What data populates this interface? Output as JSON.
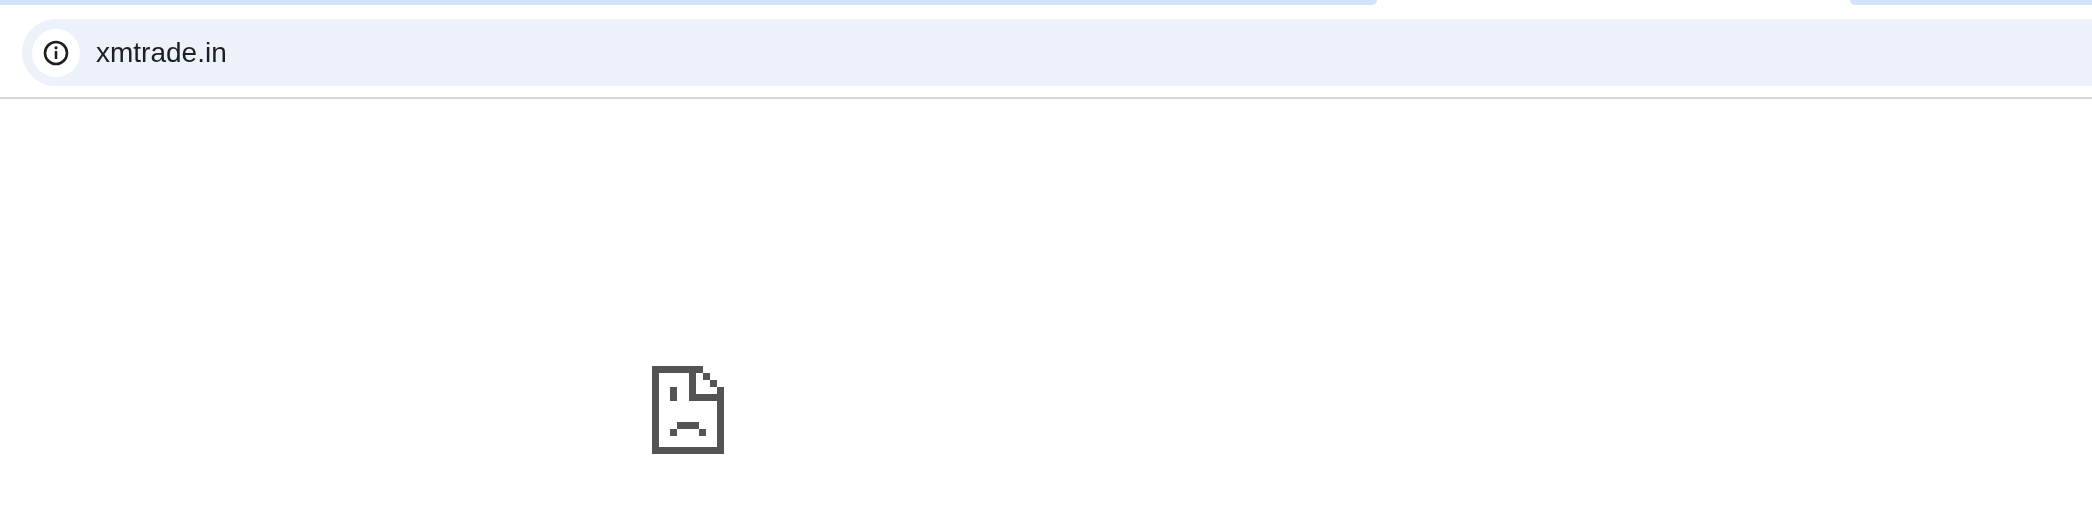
{
  "address_bar": {
    "url": "xmtrade.in"
  }
}
